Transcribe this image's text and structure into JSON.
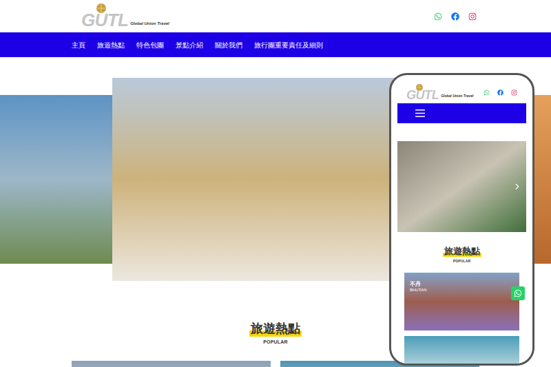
{
  "logo": {
    "mark": "GUTL",
    "name": "Global Union Travel"
  },
  "nav": [
    "主頁",
    "旅遊熱點",
    "特色包團",
    "景點介紹",
    "關於我們",
    "旅行團重要責任及細則"
  ],
  "section": {
    "title": "旅遊熱點",
    "subtitle": "POPULAR"
  },
  "mobile": {
    "card": {
      "title": "不丹",
      "subtitle": "BHUTAN"
    }
  }
}
